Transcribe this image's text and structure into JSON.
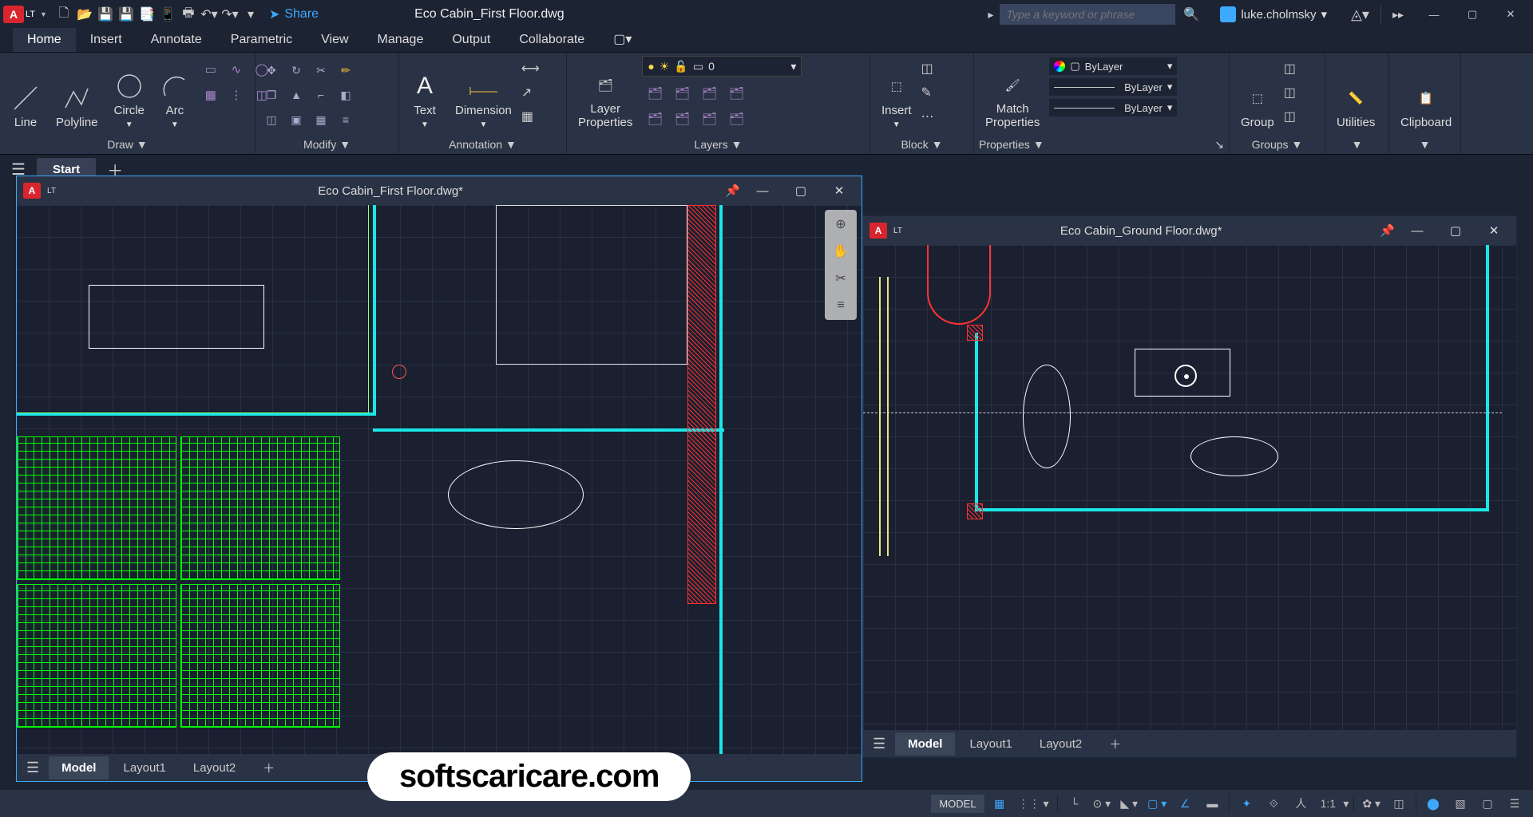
{
  "titlebar": {
    "app_badge": "A",
    "lt_badge": "LT",
    "share_label": "Share",
    "document_title": "Eco Cabin_First Floor.dwg",
    "search_placeholder": "Type a keyword or phrase",
    "user_name": "luke.cholmsky"
  },
  "menu_tabs": [
    "Home",
    "Insert",
    "Annotate",
    "Parametric",
    "View",
    "Manage",
    "Output",
    "Collaborate"
  ],
  "menu_active": 0,
  "ribbon": {
    "draw": {
      "title": "Draw",
      "line": "Line",
      "polyline": "Polyline",
      "circle": "Circle",
      "arc": "Arc"
    },
    "modify": {
      "title": "Modify"
    },
    "annotation": {
      "title": "Annotation",
      "text": "Text",
      "dimension": "Dimension"
    },
    "layers": {
      "title": "Layers",
      "layer_props": "Layer\nProperties",
      "current_layer": "0"
    },
    "block": {
      "title": "Block",
      "insert": "Insert"
    },
    "properties": {
      "title": "Properties",
      "match": "Match\nProperties",
      "bylayer": "ByLayer"
    },
    "groups": {
      "title": "Groups",
      "group": "Group"
    },
    "utilities": {
      "title": "Utilities"
    },
    "clipboard": {
      "title": "Clipboard"
    }
  },
  "start_tab": "Start",
  "doc1": {
    "title": "Eco Cabin_First Floor.dwg*",
    "tabs": [
      "Model",
      "Layout1",
      "Layout2"
    ],
    "active_tab": 0
  },
  "doc2": {
    "title": "Eco Cabin_Ground Floor.dwg*",
    "tabs": [
      "Model",
      "Layout1",
      "Layout2"
    ],
    "active_tab": 0
  },
  "statusbar": {
    "model": "MODEL",
    "scale": "1:1"
  },
  "watermark": "softscaricare.com"
}
